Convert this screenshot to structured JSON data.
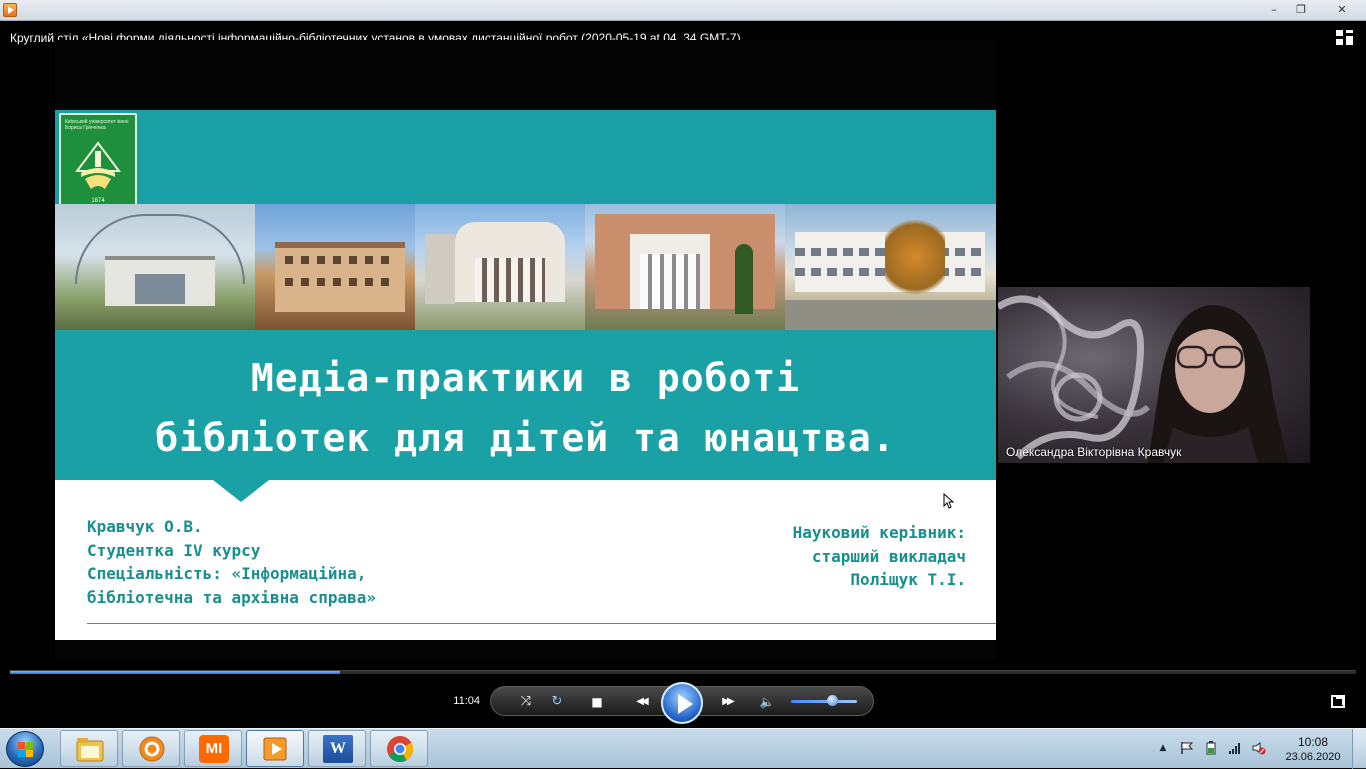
{
  "window": {
    "minimize": "–",
    "restore": "❐",
    "close": "✕"
  },
  "player": {
    "video_title": "Круглий стіл «Нові форми діяльності  інформаційно-бібліотечних установ  в умовах дистанційної робот (2020-05-19 at 04_34 GMT-7)",
    "elapsed_time": "11:04",
    "progress_fraction": 0.245,
    "volume_fraction": 0.62,
    "accent_color": "#2e6fd6"
  },
  "slide": {
    "logo_text": "Київський університет імені Бориса Грінченка",
    "logo_year": "1874",
    "title_line1": "Медіа-практики в роботі",
    "title_line2": "бібліотек для дітей та юнацтва.",
    "author": {
      "line1": "Кравчук О.В.",
      "line2": "Студентка IV курсу",
      "line3": "Спеціальність: «Інформаційна,",
      "line4": "бібліотечна та архівна справа»"
    },
    "supervisor": {
      "line1": "Науковий керівник:",
      "line2": "старший викладач",
      "line3": "Поліщук Т.І."
    },
    "teal_color": "#1aa1a6"
  },
  "webcam": {
    "participant_name": "Олександра Вікторівна Кравчук"
  },
  "controls": {
    "stop_icon": "■",
    "prev_icon": "◀◀",
    "next_icon": "▶▶",
    "volume_icon": "🔈",
    "shuffle_icon": "⤨",
    "repeat_icon": "↻"
  },
  "taskbar": {
    "items": [
      "file-explorer",
      "settings-app",
      "mi-app",
      "media-player",
      "word",
      "chrome"
    ],
    "mi_label": "MI",
    "word_label": "W",
    "tray_arrow": "▲",
    "clock_time": "10:08",
    "clock_date": "23.06.2020"
  }
}
